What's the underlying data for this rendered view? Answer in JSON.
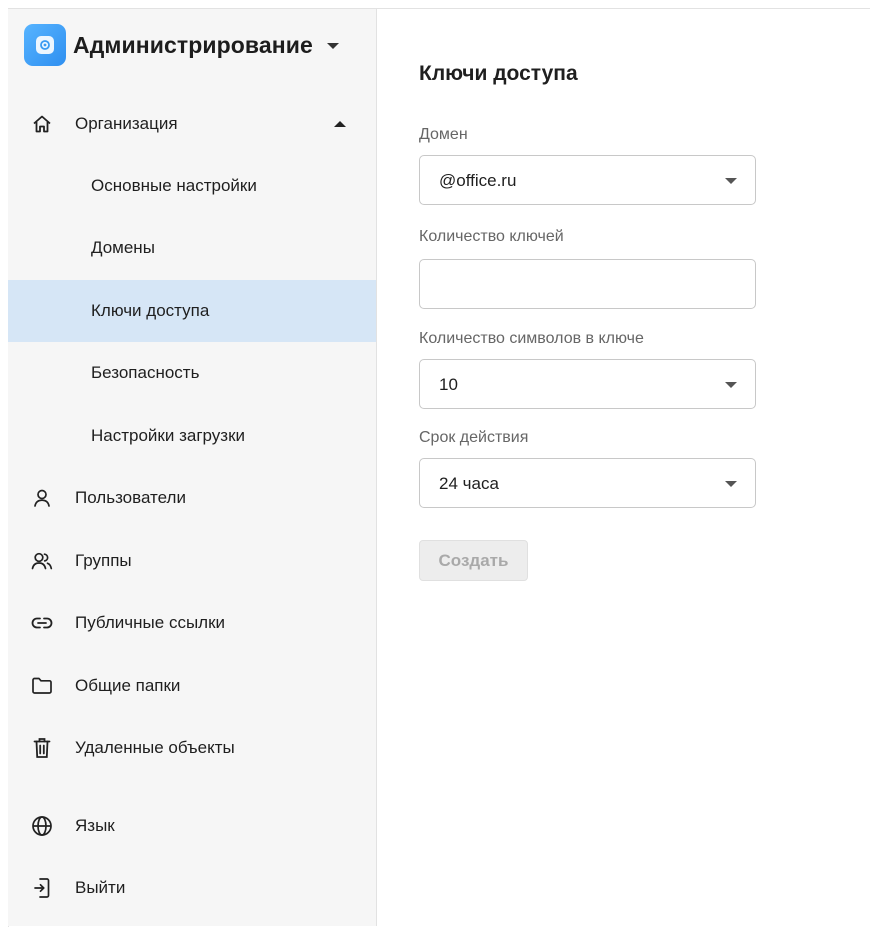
{
  "app": {
    "title": "Администрирование"
  },
  "sidebar": {
    "items": [
      {
        "label": "Организация"
      },
      {
        "label": "Основные настройки"
      },
      {
        "label": "Домены"
      },
      {
        "label": "Ключи доступа"
      },
      {
        "label": "Безопасность"
      },
      {
        "label": "Настройки загрузки"
      },
      {
        "label": "Пользователи"
      },
      {
        "label": "Группы"
      },
      {
        "label": "Публичные ссылки"
      },
      {
        "label": "Общие папки"
      },
      {
        "label": "Удаленные объекты"
      },
      {
        "label": "Язык"
      },
      {
        "label": "Выйти"
      }
    ],
    "active_item": "Ключи доступа",
    "active_color": "#d6e6f6"
  },
  "main": {
    "title": "Ключи доступа",
    "fields": {
      "domain": {
        "label": "Домен",
        "value": "@office.ru"
      },
      "key_count": {
        "label": "Количество ключей",
        "value": "",
        "placeholder": ""
      },
      "key_length": {
        "label": "Количество символов в ключе",
        "value": "10"
      },
      "validity": {
        "label": "Срок действия",
        "value": "24 часа"
      }
    },
    "create_button": {
      "label": "Создать",
      "disabled": true
    }
  },
  "icons": {
    "brand": "gear-logo-icon",
    "organization": "home-icon",
    "users": "user-icon",
    "groups": "users-icon",
    "links": "link-icon",
    "folders": "folder-icon",
    "trash": "trash-icon",
    "language": "globe-icon",
    "logout": "logout-icon"
  },
  "colors": {
    "brand_blue": "#3a9af2",
    "sidebar_bg": "#f6f6f6",
    "disabled_button_bg": "#ededed"
  }
}
